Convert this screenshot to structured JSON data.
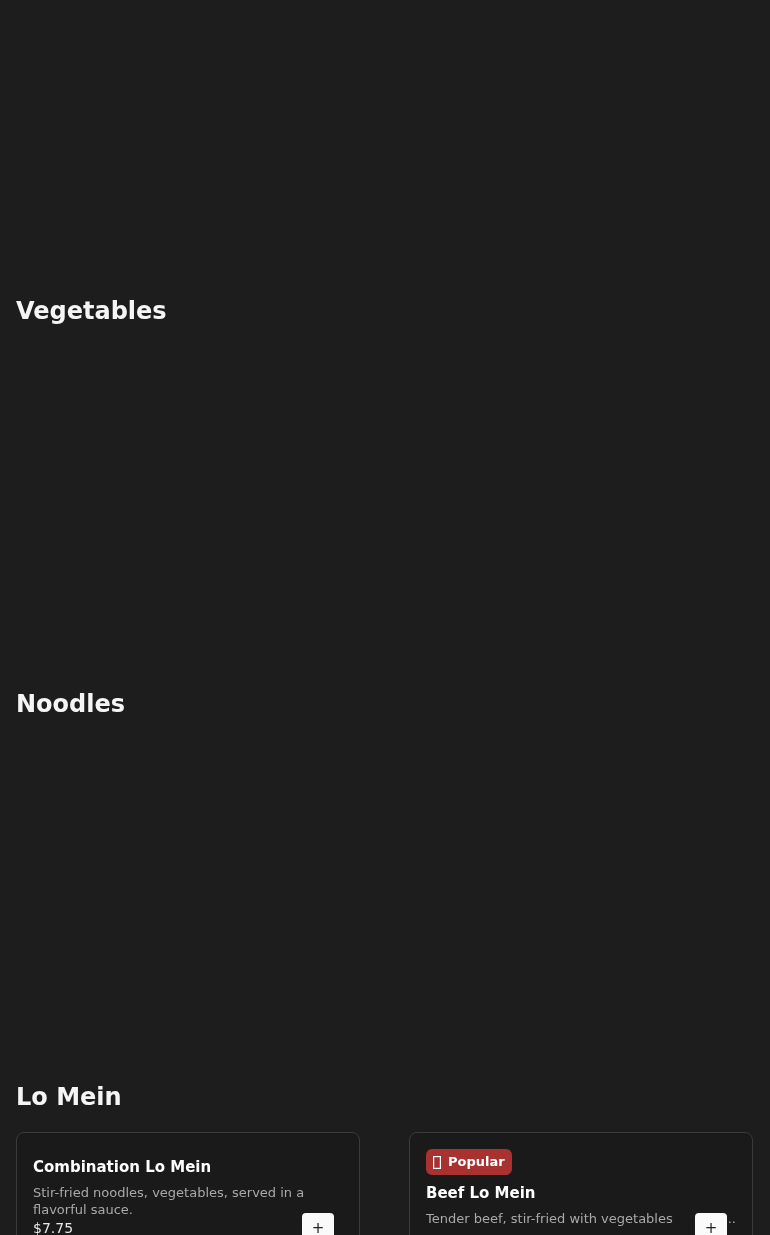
{
  "sections": [
    {
      "title": "Vegetables"
    },
    {
      "title": "Noodles"
    },
    {
      "title": "Lo Mein",
      "items": [
        {
          "name": "Combination Lo Mein",
          "description": "Stir-fried noodles, vegetables, served in a flavorful sauce.",
          "price": "$7.75",
          "add_button": "+"
        },
        {
          "badge": "Popular",
          "name": "Beef Lo Mein",
          "description": "Tender beef, stir-fried with vegetables",
          "description_tail": "..",
          "add_button": "+"
        }
      ]
    }
  ]
}
